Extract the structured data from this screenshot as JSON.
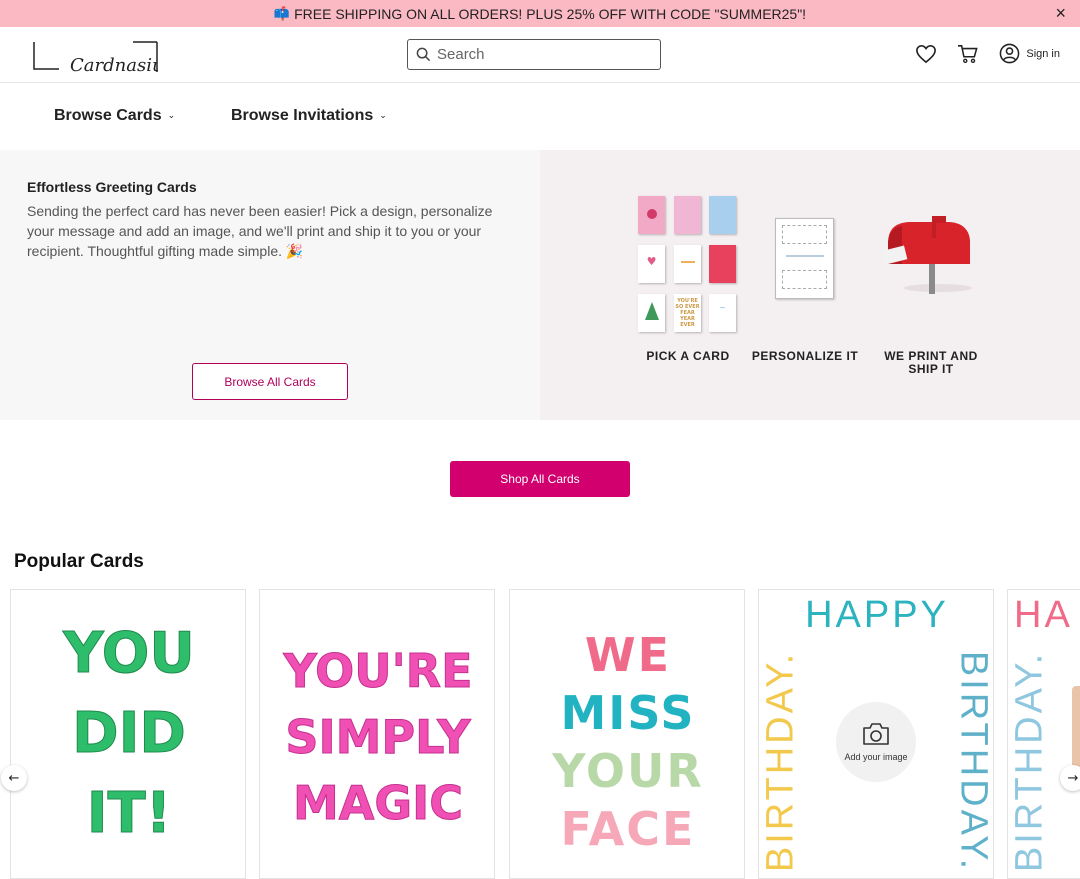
{
  "promo": {
    "text": "FREE SHIPPING ON ALL ORDERS! PLUS 25% OFF WITH CODE \"SUMMER25\"!",
    "mail_icon": "📫",
    "close_icon": "×"
  },
  "header": {
    "logo_text": "Cardnasium",
    "search_placeholder": "Search",
    "signin_label": "Sign in"
  },
  "nav": {
    "items": [
      {
        "label": "Browse Cards"
      },
      {
        "label": "Browse Invitations"
      }
    ]
  },
  "hero": {
    "title": "Effortless Greeting Cards",
    "description": "Sending the perfect card has never been easier! Pick a design, personalize your message and add an image, and we'll print and ship it to you or your recipient. Thoughtful gifting made simple. 🎉",
    "browse_button": "Browse All Cards",
    "steps": [
      {
        "label": "PICK A CARD"
      },
      {
        "label": "PERSONALIZE IT"
      },
      {
        "label": "WE PRINT AND SHIP IT"
      }
    ],
    "mini_card_texts": {
      "mini5": "YOU'RE SO EVER FEAR YEAR EVER"
    }
  },
  "shop_button": "Shop All Cards",
  "popular": {
    "title": "Popular Cards",
    "cards": [
      {
        "lines": [
          "YOU",
          "DID",
          "IT!"
        ],
        "color": "#2ebd6b"
      },
      {
        "lines": [
          "YOU'RE",
          "SIMPLY",
          "MAGIC"
        ],
        "color": "#f04fb3"
      },
      {
        "lines": [
          "WE",
          "MISS",
          "YOUR",
          "FACE"
        ]
      },
      {
        "top": "HAPPY",
        "side_left": "BIRTHDAY.",
        "side_right": "BIRTHDAY.",
        "add_image": "Add your image"
      },
      {
        "top": "HA",
        "side": "BIRTHDAY."
      }
    ]
  },
  "colors": {
    "promo_bg": "#fbb9c4",
    "accent": "#d1006e",
    "outline_accent": "#b0005a",
    "hero_right_bg": "#f4eff1"
  },
  "icons": [
    "mailbox-icon",
    "close-icon",
    "search-icon",
    "heart-icon",
    "cart-icon",
    "user-icon",
    "chevron-down-icon",
    "arrow-left-icon",
    "arrow-right-icon",
    "camera-icon"
  ]
}
